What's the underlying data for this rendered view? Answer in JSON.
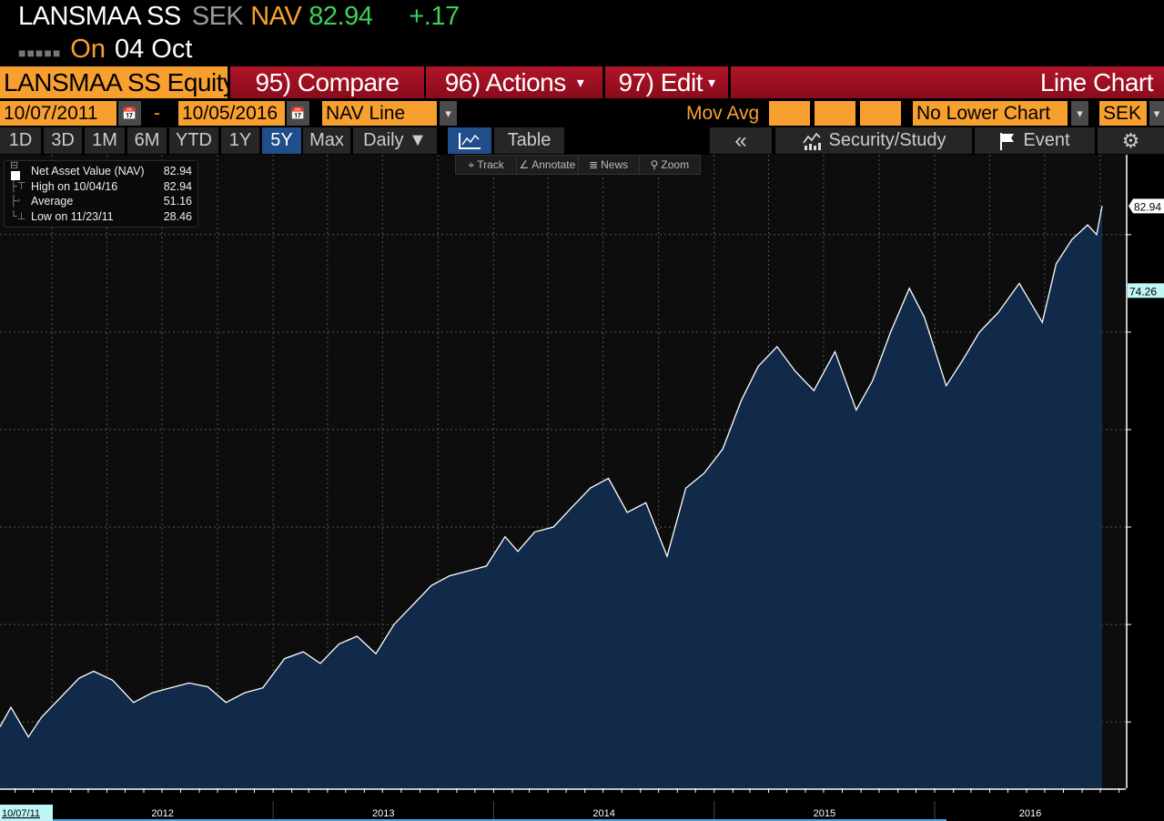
{
  "header": {
    "ticker": "LANSMAA SS",
    "currency": "SEK",
    "field": "NAV",
    "price": "82.94",
    "change": "+.17",
    "dots": "■■■■■",
    "on_label": "On",
    "date": "04 Oct"
  },
  "menu": {
    "security": "LANSMAA SS Equity",
    "compare": "95) Compare",
    "actions": "96) Actions",
    "edit": "97) Edit",
    "chart_type": "Line Chart",
    "caret": "▾"
  },
  "controls": {
    "start_date": "10/07/2011",
    "dash": "-",
    "end_date": "10/05/2016",
    "series": "NAV Line",
    "mov_avg": "Mov Avg",
    "lower_chart": "No Lower Chart",
    "currency": "SEK",
    "dd": "▾",
    "cal": "📅"
  },
  "ranges": [
    "1D",
    "3D",
    "1M",
    "6M",
    "YTD",
    "1Y",
    "5Y",
    "Max"
  ],
  "buttons": {
    "frequency": "Daily ▼",
    "table": "Table",
    "collapse": "«",
    "security_study": "Security/Study",
    "event": "Event",
    "gear": "⚙"
  },
  "tools": {
    "track": "Track",
    "annotate": "Annotate",
    "news": "News",
    "zoom": "Zoom"
  },
  "legend": [
    {
      "label": "Net Asset Value (NAV)",
      "value": "82.94"
    },
    {
      "label": "High on 10/04/16",
      "value": "82.94"
    },
    {
      "label": "Average",
      "value": "51.16"
    },
    {
      "label": "Low on 11/23/11",
      "value": "28.46"
    }
  ],
  "colors": {
    "orange": "#f7a030",
    "red": "#9c1020",
    "green": "#3ecf5a",
    "area": "#112a4a",
    "selected": "#1f4e8a"
  },
  "chart_data": {
    "type": "area",
    "title": "LANSMAA SS NAV Line Chart",
    "xlabel": "",
    "ylabel": "",
    "ylim": [
      23.2,
      88.2
    ],
    "yticks": [
      30,
      40,
      50,
      60,
      70,
      80
    ],
    "xticks": [
      "2012",
      "2013",
      "2014",
      "2015",
      "2016"
    ],
    "start_label": "10/07/11",
    "last_value_label": "82.94",
    "reference_label": "74.26",
    "reference_value": 74.26,
    "grid": true,
    "series": [
      {
        "name": "Net Asset Value (NAV)",
        "points": [
          [
            "2011-10-07",
            29.5
          ],
          [
            "2011-10-25",
            31.5
          ],
          [
            "2011-11-23",
            28.46
          ],
          [
            "2011-12-15",
            30.5
          ],
          [
            "2012-01-15",
            32.5
          ],
          [
            "2012-02-15",
            34.5
          ],
          [
            "2012-03-10",
            35.2
          ],
          [
            "2012-04-10",
            34.3
          ],
          [
            "2012-05-15",
            32.0
          ],
          [
            "2012-06-15",
            33.0
          ],
          [
            "2012-07-15",
            33.5
          ],
          [
            "2012-08-15",
            34.0
          ],
          [
            "2012-09-15",
            33.6
          ],
          [
            "2012-10-15",
            32.0
          ],
          [
            "2012-11-15",
            33.0
          ],
          [
            "2012-12-15",
            33.5
          ],
          [
            "2013-01-20",
            36.5
          ],
          [
            "2013-02-20",
            37.2
          ],
          [
            "2013-03-20",
            36.0
          ],
          [
            "2013-04-20",
            38.0
          ],
          [
            "2013-05-20",
            38.8
          ],
          [
            "2013-06-20",
            37.0
          ],
          [
            "2013-07-20",
            40.0
          ],
          [
            "2013-08-20",
            42.0
          ],
          [
            "2013-09-20",
            44.0
          ],
          [
            "2013-10-20",
            45.0
          ],
          [
            "2013-11-20",
            45.5
          ],
          [
            "2013-12-20",
            46.0
          ],
          [
            "2014-01-20",
            49.0
          ],
          [
            "2014-02-10",
            47.5
          ],
          [
            "2014-03-10",
            49.5
          ],
          [
            "2014-04-10",
            50.0
          ],
          [
            "2014-05-10",
            52.0
          ],
          [
            "2014-06-10",
            54.0
          ],
          [
            "2014-07-10",
            55.0
          ],
          [
            "2014-08-10",
            51.5
          ],
          [
            "2014-09-10",
            52.5
          ],
          [
            "2014-10-15",
            47.0
          ],
          [
            "2014-11-15",
            54.0
          ],
          [
            "2014-12-15",
            55.5
          ],
          [
            "2015-01-15",
            58.0
          ],
          [
            "2015-02-15",
            63.0
          ],
          [
            "2015-03-15",
            66.5
          ],
          [
            "2015-04-15",
            68.5
          ],
          [
            "2015-05-15",
            66.0
          ],
          [
            "2015-06-15",
            64.0
          ],
          [
            "2015-07-20",
            68.0
          ],
          [
            "2015-08-24",
            62.0
          ],
          [
            "2015-09-20",
            65.0
          ],
          [
            "2015-10-20",
            70.0
          ],
          [
            "2015-11-20",
            74.5
          ],
          [
            "2015-12-15",
            71.5
          ],
          [
            "2016-01-20",
            64.5
          ],
          [
            "2016-02-15",
            67.0
          ],
          [
            "2016-03-15",
            70.0
          ],
          [
            "2016-04-15",
            72.0
          ],
          [
            "2016-05-20",
            75.0
          ],
          [
            "2016-06-27",
            71.0
          ],
          [
            "2016-07-20",
            77.0
          ],
          [
            "2016-08-15",
            79.5
          ],
          [
            "2016-09-10",
            81.0
          ],
          [
            "2016-09-25",
            80.0
          ],
          [
            "2016-10-04",
            82.94
          ]
        ]
      }
    ]
  }
}
